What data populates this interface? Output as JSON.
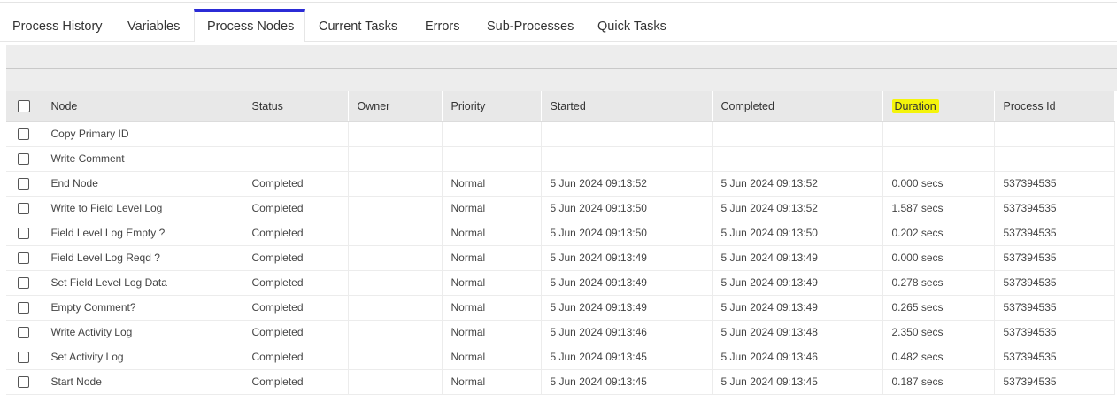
{
  "tabs": [
    {
      "label": "Process History"
    },
    {
      "label": "Variables"
    },
    {
      "label": "Process Nodes"
    },
    {
      "label": "Current Tasks"
    },
    {
      "label": "Errors"
    },
    {
      "label": "Sub-Processes"
    },
    {
      "label": "Quick Tasks"
    }
  ],
  "active_tab": "Process Nodes",
  "highlight_color": "#f4f40b",
  "accent_color": "#2b2bd6",
  "table": {
    "columns": [
      "Node",
      "Status",
      "Owner",
      "Priority",
      "Started",
      "Completed",
      "Duration",
      "Process Id"
    ],
    "highlighted_column": "Duration",
    "rows": [
      {
        "node": "Copy Primary ID",
        "status": "",
        "owner": "",
        "priority": "",
        "started": "",
        "completed": "",
        "duration": "",
        "process_id": ""
      },
      {
        "node": "Write Comment",
        "status": "",
        "owner": "",
        "priority": "",
        "started": "",
        "completed": "",
        "duration": "",
        "process_id": ""
      },
      {
        "node": "End Node",
        "status": "Completed",
        "owner": "",
        "priority": "Normal",
        "started": "5 Jun 2024 09:13:52",
        "completed": "5 Jun 2024 09:13:52",
        "duration": "0.000 secs",
        "process_id": "537394535"
      },
      {
        "node": "Write to Field Level Log",
        "status": "Completed",
        "owner": "",
        "priority": "Normal",
        "started": "5 Jun 2024 09:13:50",
        "completed": "5 Jun 2024 09:13:52",
        "duration": "1.587 secs",
        "process_id": "537394535"
      },
      {
        "node": "Field Level Log Empty ?",
        "status": "Completed",
        "owner": "",
        "priority": "Normal",
        "started": "5 Jun 2024 09:13:50",
        "completed": "5 Jun 2024 09:13:50",
        "duration": "0.202 secs",
        "process_id": "537394535"
      },
      {
        "node": "Field Level Log Reqd ?",
        "status": "Completed",
        "owner": "",
        "priority": "Normal",
        "started": "5 Jun 2024 09:13:49",
        "completed": "5 Jun 2024 09:13:49",
        "duration": "0.000 secs",
        "process_id": "537394535"
      },
      {
        "node": "Set Field Level Log Data",
        "status": "Completed",
        "owner": "",
        "priority": "Normal",
        "started": "5 Jun 2024 09:13:49",
        "completed": "5 Jun 2024 09:13:49",
        "duration": "0.278 secs",
        "process_id": "537394535"
      },
      {
        "node": "Empty Comment?",
        "status": "Completed",
        "owner": "",
        "priority": "Normal",
        "started": "5 Jun 2024 09:13:49",
        "completed": "5 Jun 2024 09:13:49",
        "duration": "0.265 secs",
        "process_id": "537394535"
      },
      {
        "node": "Write Activity Log",
        "status": "Completed",
        "owner": "",
        "priority": "Normal",
        "started": "5 Jun 2024 09:13:46",
        "completed": "5 Jun 2024 09:13:48",
        "duration": "2.350 secs",
        "process_id": "537394535"
      },
      {
        "node": "Set Activity Log",
        "status": "Completed",
        "owner": "",
        "priority": "Normal",
        "started": "5 Jun 2024 09:13:45",
        "completed": "5 Jun 2024 09:13:46",
        "duration": "0.482 secs",
        "process_id": "537394535"
      },
      {
        "node": "Start Node",
        "status": "Completed",
        "owner": "",
        "priority": "Normal",
        "started": "5 Jun 2024 09:13:45",
        "completed": "5 Jun 2024 09:13:45",
        "duration": "0.187 secs",
        "process_id": "537394535"
      }
    ]
  }
}
